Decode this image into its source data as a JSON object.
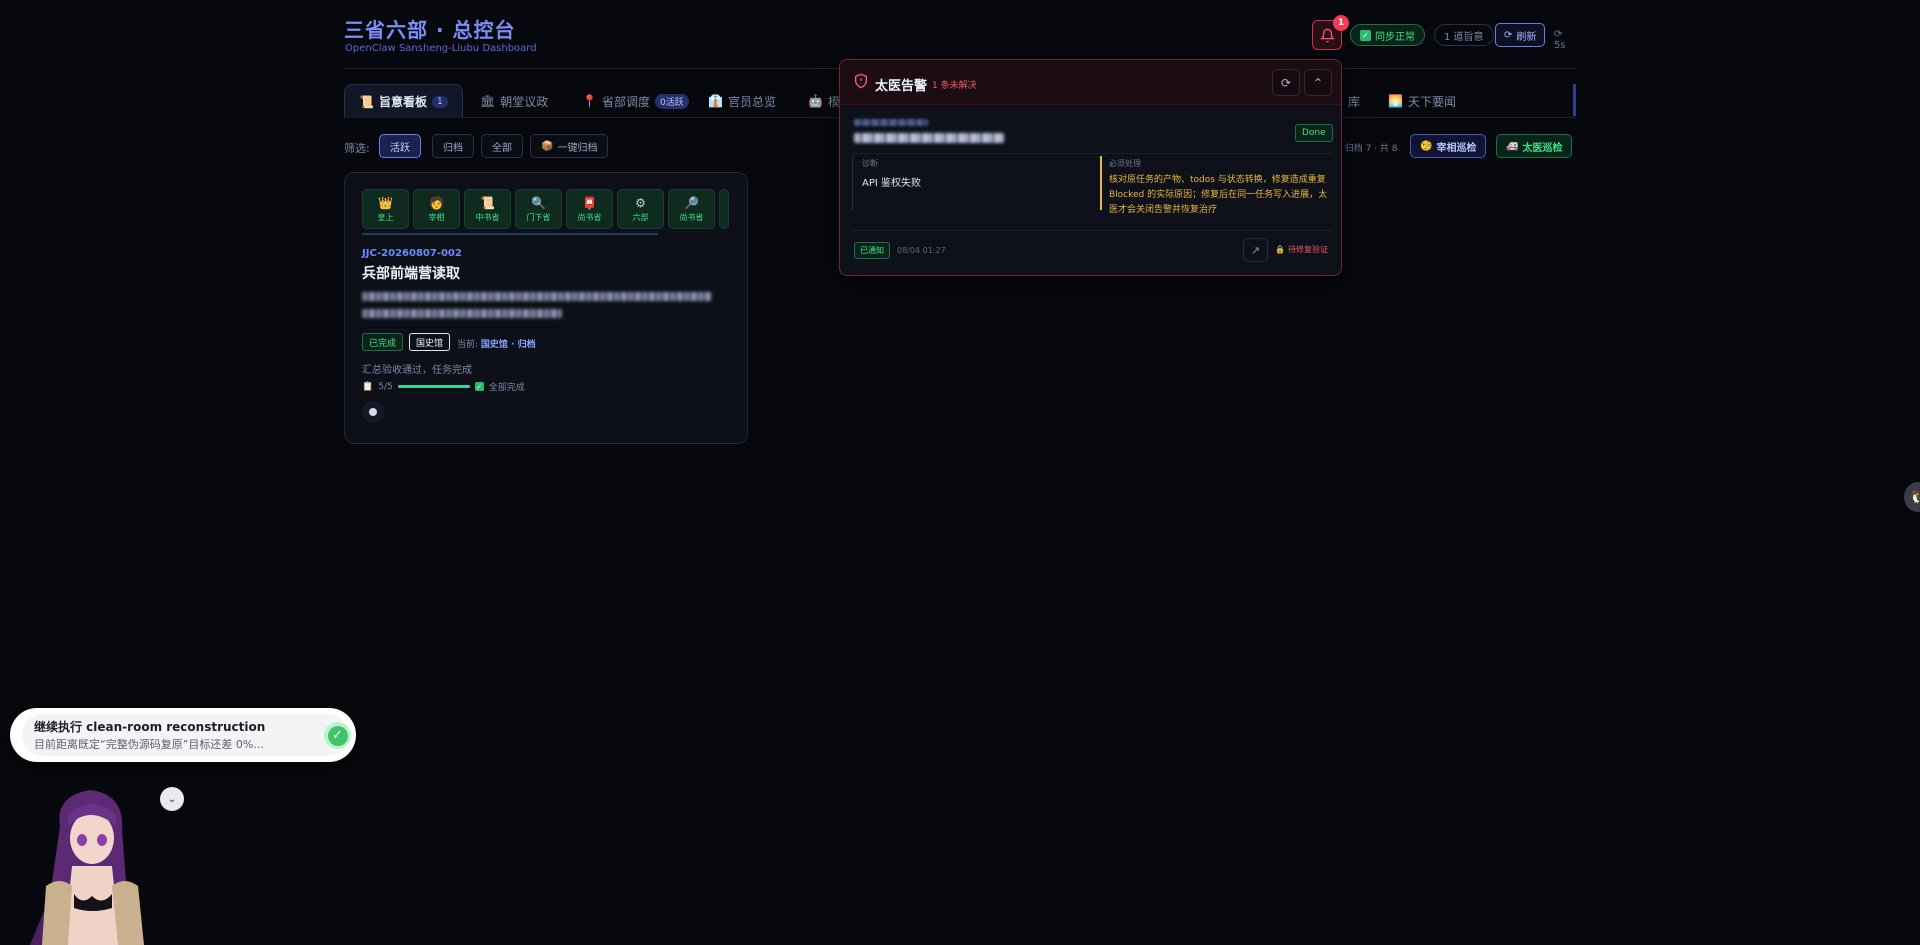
{
  "header": {
    "title": "三省六部 · 总控台",
    "subtitle": "OpenClaw Sansheng-Liubu Dashboard",
    "bell_badge": "1",
    "sync_status": "同步正常",
    "edict_count": "1 道旨意",
    "refresh_label": "刷新",
    "interval": "5s"
  },
  "tabs": [
    {
      "icon": "📜",
      "label": "旨意看板",
      "count": "1"
    },
    {
      "icon": "🏛",
      "label": "朝堂议政"
    },
    {
      "icon": "📍",
      "label": "省部调度",
      "count": "0活跃"
    },
    {
      "icon": "👔",
      "label": "官员总览"
    },
    {
      "icon": "🤖",
      "label": "模"
    },
    {
      "icon": "",
      "label": "库"
    },
    {
      "icon": "🌅",
      "label": "天下要闻"
    }
  ],
  "filters": {
    "label": "筛选:",
    "options": [
      "活跃",
      "归档",
      "全部"
    ],
    "archive_all": "一键归档",
    "stats": "· 归档 7 · 共 8",
    "patrol_chancellor": "宰相巡检",
    "patrol_physician": "太医巡检"
  },
  "task": {
    "steps": [
      {
        "icon": "👑",
        "label": "皇上"
      },
      {
        "icon": "🧑",
        "label": "宰相"
      },
      {
        "icon": "📜",
        "label": "中书省"
      },
      {
        "icon": "🔍",
        "label": "门下省"
      },
      {
        "icon": "📮",
        "label": "尚书省"
      },
      {
        "icon": "⚙",
        "label": "六部"
      },
      {
        "icon": "🔎",
        "label": "尚书省"
      }
    ],
    "id": "JJC-20260807-002",
    "title": "兵部前端营读取",
    "status": "已完成",
    "stage_tag": "国史馆",
    "current_label": "当前:",
    "current_value": "国史馆 · 归档",
    "summary": "汇总验收通过，任务完成",
    "progress_text": "5/5",
    "progress_fraction": 1.0,
    "progress_done": "全部完成"
  },
  "alert": {
    "title": "太医告警",
    "unresolved": "1 条未解决",
    "status_pill": "Done",
    "diagnosis_label": "诊断",
    "diagnosis_value": "API 鉴权失败",
    "action_label": "必须处理",
    "action_value": "核对原任务的产物、todos 与状态转换，修复造成重复 Blocked 的实际原因；修复后在同一任务写入进展，太医才会关闭告警并恢复治疗",
    "notified": "已通知",
    "time": "08/04 01:27",
    "pending": "待修复验证"
  },
  "toast": {
    "title": "继续执行 clean-room reconstruction",
    "body": "目前距离既定“完整伪源码复原”目标还差 0%..."
  },
  "colors": {
    "accent": "#7a8ef7",
    "success": "#3ee08a",
    "danger": "#f0566a",
    "warning": "#e8b73f"
  }
}
